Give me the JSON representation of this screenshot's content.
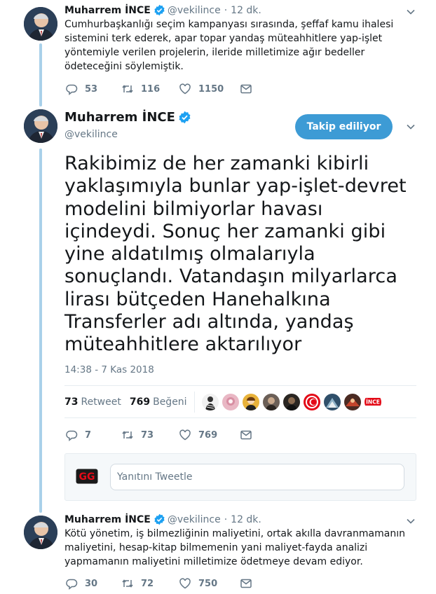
{
  "colors": {
    "accent": "#3d9bd5",
    "thread_line": "#a9d1ea",
    "secondary_text": "#657786",
    "verified": "#1da1f2"
  },
  "tweets": [
    {
      "name": "Muharrem İNCE",
      "handle": "@vekilince",
      "time": "12 dk.",
      "lines": [
        "Cumhurbaşkanlığı seçim kampanyası sırasında, şeffaf kamu ihalesi",
        "sistemini terk ederek, apar topar yandaş müteahhitlere yap-işlet",
        "yöntemiyle verilen projelerin, ileride milletimize ağır bedeller",
        "ödeteceğini söylemiştik."
      ],
      "replies": "53",
      "retweets": "116",
      "likes": "1150"
    },
    {
      "name": "Muharrem İNCE",
      "handle": "@vekilince",
      "follow_label": "Takip ediliyor",
      "lines": [
        "Rakibimiz de her zamanki kibirli",
        "yaklaşımıyla bunlar yap-işlet-devret",
        "modelini bilmiyorlar havası",
        "içindeydi. Sonuç her zamanki gibi",
        "yine aldatılmış olmalarıyla",
        "sonuçlandı. Vatandaşın milyarlarca",
        "lirası bütçeden Hanehalkına",
        "Transferler adı altında, yandaş",
        "müteahhitlere aktarılıyor"
      ],
      "timestamp": "14:38 - 7 Kas 2018",
      "retweet_count": "73",
      "retweet_label": "Retweet",
      "like_count": "769",
      "like_label": "Beğeni",
      "likers_logo_text": "İNCE",
      "replies": "7",
      "retweets": "73",
      "likes": "769"
    },
    {
      "name": "Muharrem İNCE",
      "handle": "@vekilince",
      "time": "12 dk.",
      "lines": [
        "Kötü yönetim, iş bilmezliğinin maliyetini, ortak akılla davranmamanın",
        "maliyetini, hesap-kitap bilmemenin yani maliyet-fayda analizi",
        "yapmamanın maliyetini milletimize ödetmeye devam ediyor."
      ],
      "replies": "30",
      "retweets": "72",
      "likes": "750"
    }
  ],
  "reply": {
    "logo_text": "GG",
    "placeholder": "Yanıtını Tweetle"
  },
  "icons": {
    "reply": "reply-icon",
    "retweet": "retweet-icon",
    "like": "heart-icon",
    "message": "envelope-icon",
    "verified": "verified-badge-icon",
    "more": "chevron-down-icon"
  }
}
